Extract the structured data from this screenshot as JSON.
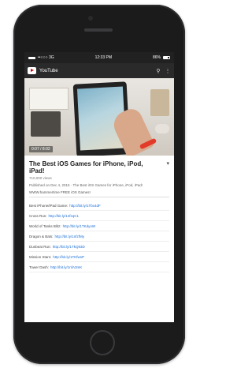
{
  "status_bar": {
    "carrier": "••○○○ 3G",
    "time": "12:33 PM",
    "battery": "86%"
  },
  "app_bar": {
    "logo_icon": "youtube-logo-icon",
    "title": "YouTube",
    "search_icon": "search-icon",
    "menu_icon": "more-vertical-icon"
  },
  "video": {
    "time": "0:07 / 8:02",
    "title": "The Best iOS Games for iPhone, iPod, iPad!",
    "views": "710,000 views",
    "description": "Published on Dec 4, 2015 · The Best iOS Games for iPhone, iPod, iPad!",
    "download_text": "WWW.hammertime FREE iOS Games!"
  },
  "list": [
    {
      "label": "Best iPhone/iPad Game:",
      "link": "http://bit.ly/1Tbx4dF"
    },
    {
      "label": "Cross Run:",
      "link": "http://bit.ly/1nfzqC1"
    },
    {
      "label": "World of Tanks Blitz:",
      "link": "http://bit.ly/1TKdyoW"
    },
    {
      "label": "Dragon & Bats:",
      "link": "http://bit.ly/1nfzfMy"
    },
    {
      "label": "Dunbeat Run:",
      "link": "http://bit.ly/1TkQ83D"
    },
    {
      "label": "Mission Stars:",
      "link": "http://bit.ly/1TKfwsP"
    },
    {
      "label": "Tower Dash:",
      "link": "http://bit.ly/1nfA3mK"
    }
  ]
}
